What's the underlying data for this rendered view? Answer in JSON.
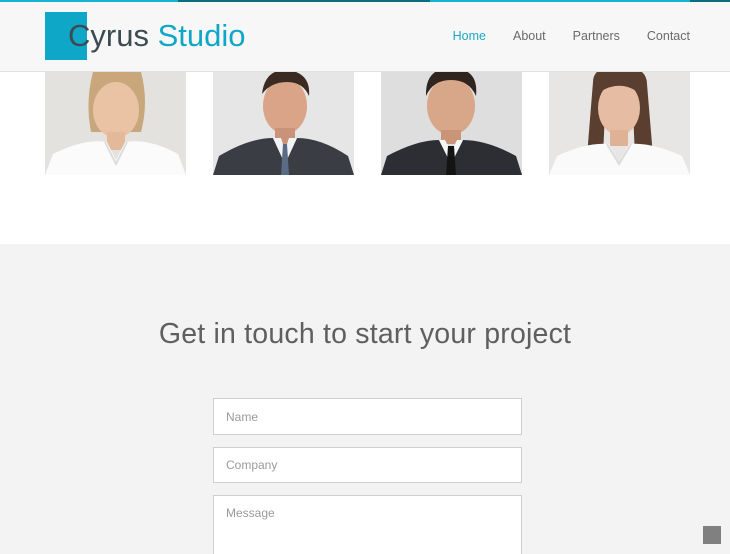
{
  "header": {
    "logo": {
      "part1": "C",
      "part2": "yrus",
      "part3": " Studio"
    },
    "nav": [
      {
        "label": "Home",
        "active": true
      },
      {
        "label": "About",
        "active": false
      },
      {
        "label": "Partners",
        "active": false
      },
      {
        "label": "Contact",
        "active": false
      }
    ]
  },
  "team": {
    "photos": [
      {
        "subject": "woman with blonde hair in white shirt"
      },
      {
        "subject": "man in dark suit"
      },
      {
        "subject": "man in dark suit and tie"
      },
      {
        "subject": "woman with brown hair in white shirt"
      }
    ]
  },
  "contact": {
    "heading": "Get in touch to start your project",
    "form": {
      "name_placeholder": "Name",
      "company_placeholder": "Company",
      "message_placeholder": "Message"
    }
  },
  "colors": {
    "accent": "#0fa7c8",
    "nav_active": "#1aa8c4",
    "section_bg": "#f3f3f3"
  }
}
